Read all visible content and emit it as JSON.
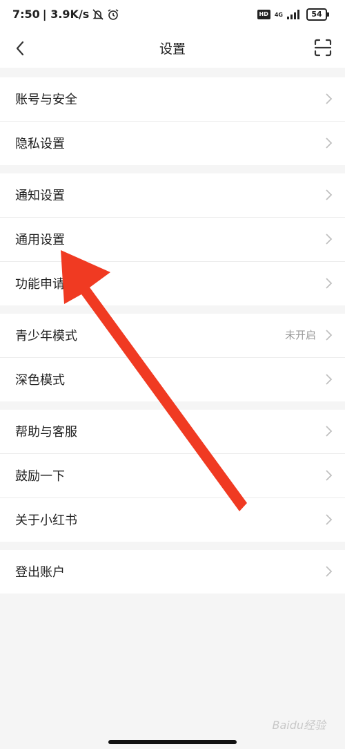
{
  "status": {
    "time": "7:50",
    "speed": "| 3.9K/s",
    "hd": "HD",
    "net": "4G",
    "battery": "54"
  },
  "nav": {
    "title": "设置"
  },
  "groups": [
    {
      "items": [
        {
          "label": "账号与安全"
        },
        {
          "label": "隐私设置"
        }
      ]
    },
    {
      "items": [
        {
          "label": "通知设置"
        },
        {
          "label": "通用设置"
        },
        {
          "label": "功能申请"
        }
      ]
    },
    {
      "items": [
        {
          "label": "青少年模式",
          "value": "未开启"
        },
        {
          "label": "深色模式"
        }
      ]
    },
    {
      "items": [
        {
          "label": "帮助与客服"
        },
        {
          "label": "鼓励一下"
        },
        {
          "label": "关于小红书"
        }
      ]
    },
    {
      "items": [
        {
          "label": "登出账户"
        }
      ]
    }
  ],
  "watermark": "Baidu经验",
  "colors": {
    "arrow": "#f03a22",
    "background": "#f5f5f5",
    "row": "#ffffff",
    "chevron": "#c0c0c0"
  },
  "icons": {
    "back": "chevron-left-icon",
    "scan": "scan-icon",
    "row_chevron": "chevron-right-icon",
    "silent": "bell-off-icon",
    "alarm": "alarm-clock-icon"
  }
}
